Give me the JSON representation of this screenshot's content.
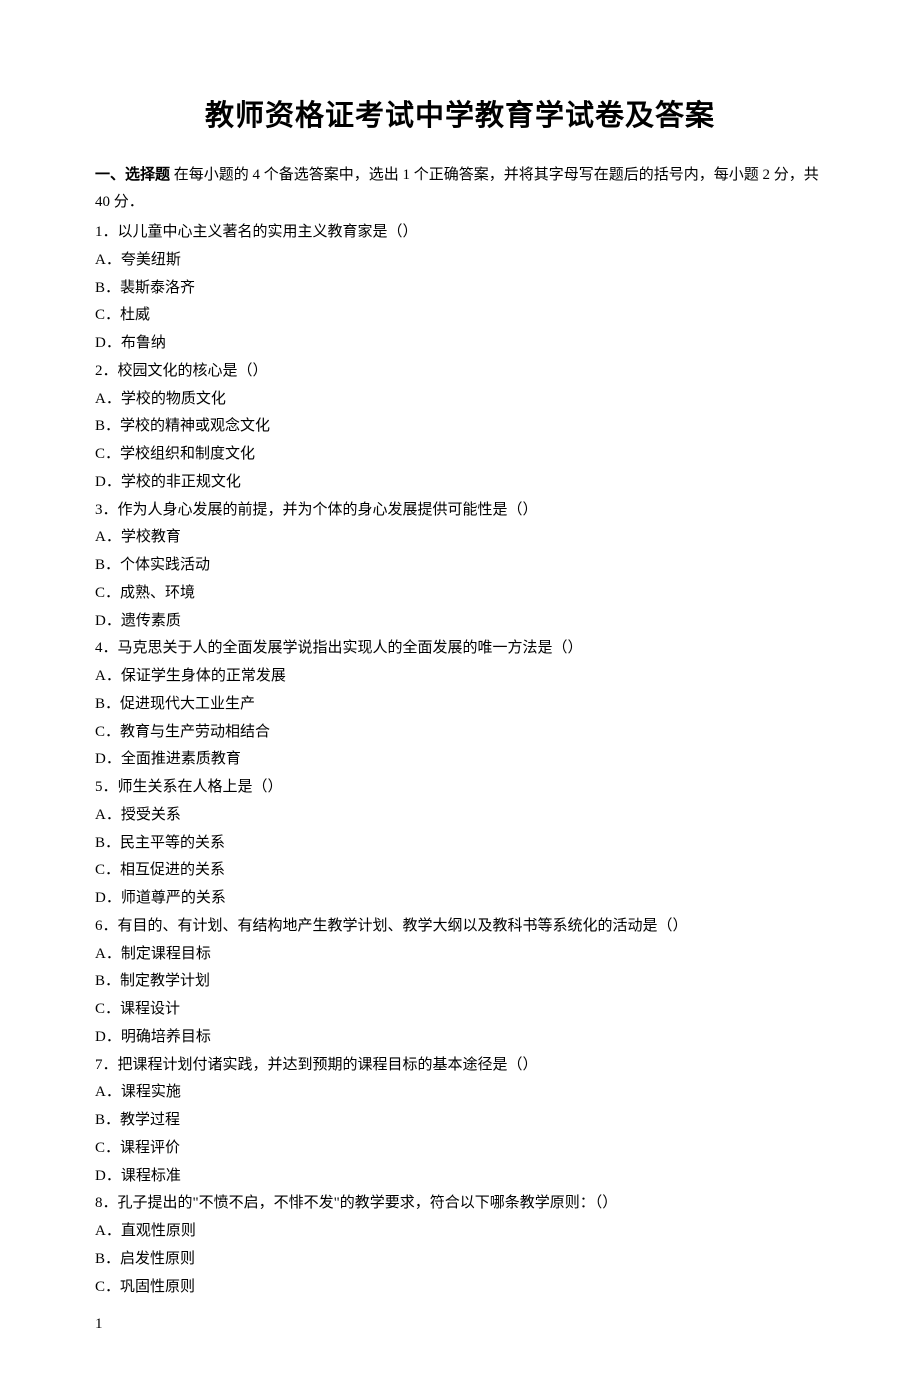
{
  "title": "教师资格证考试中学教育学试卷及答案",
  "section": {
    "label": "一、选择题",
    "instructions": "在每小题的 4 个备选答案中，选出 1 个正确答案，并将其字母写在题后的括号内，每小题 2 分，共 40 分．"
  },
  "questions": [
    {
      "num": "1．",
      "text": "以儿童中心主义著名的实用主义教育家是（）",
      "options": [
        "A．夸美纽斯",
        "B．裴斯泰洛齐",
        "C．杜威",
        "D．布鲁纳"
      ]
    },
    {
      "num": "2．",
      "text": "校园文化的核心是（）",
      "options": [
        "A．学校的物质文化",
        "B．学校的精神或观念文化",
        "C．学校组织和制度文化",
        "D．学校的非正规文化"
      ]
    },
    {
      "num": "3．",
      "text": "作为人身心发展的前提，并为个体的身心发展提供可能性是（）",
      "options": [
        "A．学校教育",
        "B．个体实践活动",
        "C．成熟、环境",
        "D．遗传素质"
      ]
    },
    {
      "num": "4．",
      "text": "马克思关于人的全面发展学说指出实现人的全面发展的唯一方法是（）",
      "options": [
        "A．保证学生身体的正常发展",
        "B．促进现代大工业生产",
        "C．教育与生产劳动相结合",
        "D．全面推进素质教育"
      ]
    },
    {
      "num": "5．",
      "text": "师生关系在人格上是（）",
      "options": [
        "A．授受关系",
        "B．民主平等的关系",
        "C．相互促进的关系",
        "D．师道尊严的关系"
      ]
    },
    {
      "num": "6．",
      "text": "有目的、有计划、有结构地产生教学计划、教学大纲以及教科书等系统化的活动是（）",
      "options": [
        "A．制定课程目标",
        "B．制定教学计划",
        "C．课程设计",
        "D．明确培养目标"
      ]
    },
    {
      "num": "7．",
      "text": "把课程计划付诸实践，并达到预期的课程目标的基本途径是（）",
      "options": [
        "A．课程实施",
        "B．教学过程",
        "C．课程评价",
        "D．课程标准"
      ]
    },
    {
      "num": "8．",
      "text": "孔子提出的\"不愤不启，不悱不发\"的教学要求，符合以下哪条教学原则：（）",
      "options": [
        "A．直观性原则",
        "B．启发性原则",
        "C．巩固性原则"
      ]
    }
  ],
  "pageNumber": "1"
}
